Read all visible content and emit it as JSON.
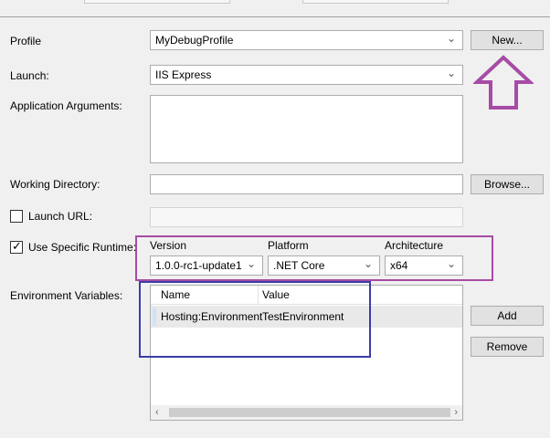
{
  "profile": {
    "label": "Profile",
    "value": "MyDebugProfile",
    "new_button": "New..."
  },
  "launch": {
    "label": "Launch:",
    "value": "IIS Express"
  },
  "app_args": {
    "label": "Application Arguments:",
    "value": ""
  },
  "working_dir": {
    "label": "Working Directory:",
    "value": "",
    "browse_button": "Browse..."
  },
  "launch_url": {
    "label": "Launch URL:",
    "checked": false,
    "value": ""
  },
  "specific_runtime": {
    "label": "Use Specific Runtime:",
    "checked": true,
    "version_label": "Version",
    "version_value": "1.0.0-rc1-update1",
    "platform_label": "Platform",
    "platform_value": ".NET Core",
    "architecture_label": "Architecture",
    "architecture_value": "x64"
  },
  "env_vars": {
    "label": "Environment Variables:",
    "columns": [
      "Name",
      "Value"
    ],
    "rows": [
      {
        "name": "Hosting:Environment",
        "value": "TestEnvironment"
      }
    ],
    "add_button": "Add",
    "remove_button": "Remove"
  },
  "annotation_colors": {
    "arrow": "#a64ca6",
    "runtime_box": "#a64ca6",
    "env_box": "#3c3ca8"
  },
  "icons": {
    "dropdown": "chevron-down-icon",
    "check": "check-icon"
  }
}
